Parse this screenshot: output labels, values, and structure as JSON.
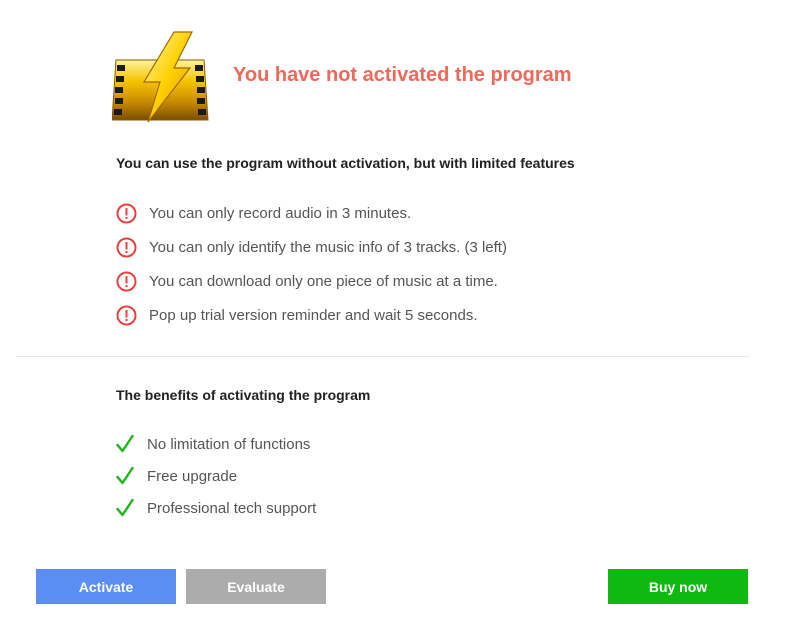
{
  "header": {
    "logo_icon": "film-lightning-logo-icon",
    "title": "You have not activated the program",
    "title_color": "#f0685a"
  },
  "limitations": {
    "heading": "You can use the program without activation, but with limited features",
    "icon": "exclamation-circle-icon",
    "icon_color": "#e84040",
    "items": [
      "You can only record audio in 3 minutes.",
      "You can only identify the music info of 3 tracks. (3 left)",
      "You can download only one piece of music at a time.",
      "Pop up trial version reminder and wait 5 seconds."
    ]
  },
  "benefits": {
    "heading": "The benefits of activating the program",
    "icon": "checkmark-icon",
    "icon_color": "#1db51d",
    "items": [
      "No limitation of functions",
      "Free upgrade",
      "Professional tech support"
    ]
  },
  "buttons": {
    "activate_label": "Activate",
    "evaluate_label": "Evaluate",
    "buy_label": "Buy now",
    "activate_color": "#5b8ef2",
    "evaluate_color": "#acacac",
    "buy_color": "#0fb90f"
  }
}
